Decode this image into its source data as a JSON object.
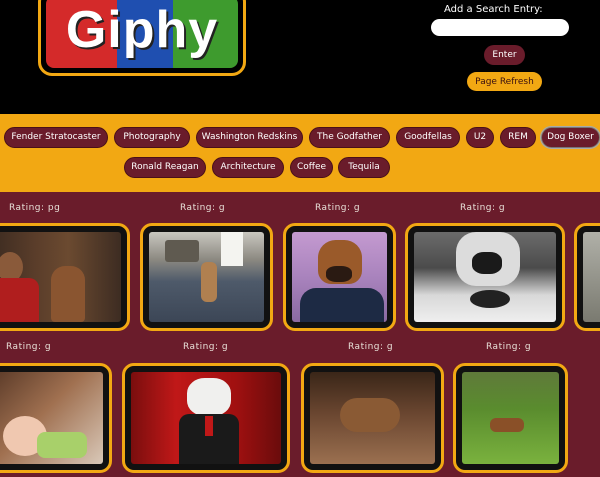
{
  "header": {
    "logo_text": "Giphy",
    "search_label": "Add a Search Entry:",
    "search_value": "",
    "enter_label": "Enter",
    "refresh_label": "Page Refresh"
  },
  "topics": [
    "Fender Stratocaster",
    "Photography",
    "Washington Redskins",
    "The Godfather",
    "Goodfellas",
    "U2",
    "REM",
    "Dog Boxer",
    "Ronald Reagan",
    "Architecture",
    "Coffee",
    "Tequila"
  ],
  "active_topic": "Dog Boxer",
  "gallery": {
    "row1": [
      {
        "rating": "Rating: pg",
        "subject": "boy with boxer dog"
      },
      {
        "rating": "Rating: g",
        "subject": "boxer in living room"
      },
      {
        "rating": "Rating: g",
        "subject": "boxer head on body"
      },
      {
        "rating": "Rating: g",
        "subject": "boxer close-up"
      },
      {
        "rating": "",
        "subject": "partial gif"
      }
    ],
    "row2": [
      {
        "rating": "Rating: g",
        "subject": "baby with boxer"
      },
      {
        "rating": "Rating: g",
        "subject": "boxer in suit at podium"
      },
      {
        "rating": "Rating: g",
        "subject": "boxer on couch"
      },
      {
        "rating": "Rating: g",
        "subject": "boxer on grass"
      }
    ]
  },
  "colors": {
    "maroon": "#6a1c2b",
    "gold": "#f2a813",
    "black": "#000000"
  }
}
